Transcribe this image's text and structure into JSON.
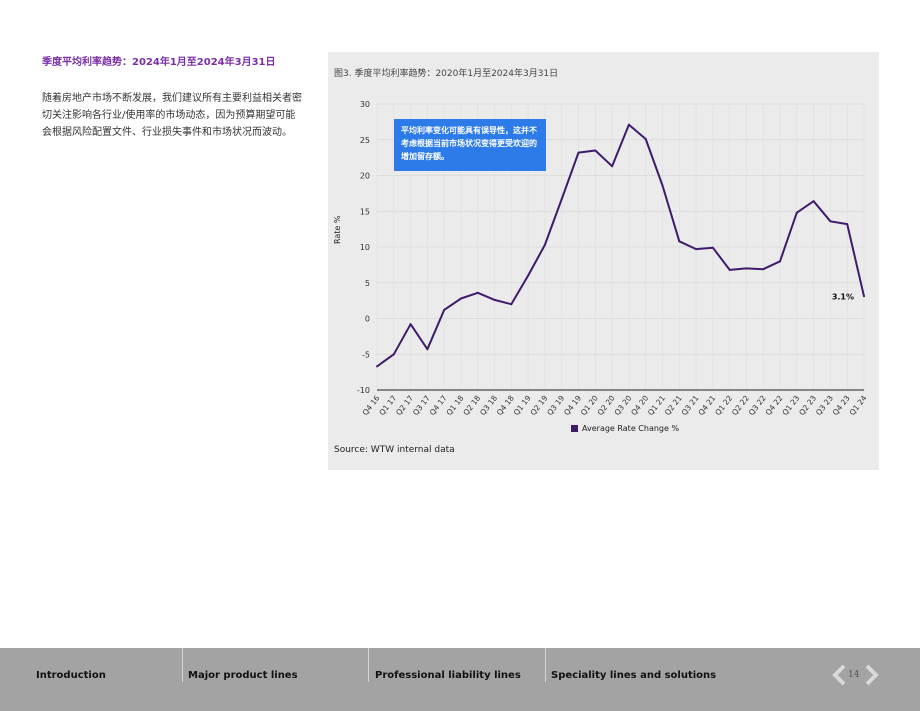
{
  "page": {
    "section_title": "季度平均利率趋势：2024年1月至2024年3月31日",
    "intro_text": "随着房地产市场不断发展，我们建议所有主要利益相关者密切关注影响各行业/使用率的市场动态，因为预算期望可能会根据风险配置文件、行业损失事件和市场状况而波动。"
  },
  "chart_data": {
    "type": "line",
    "caption": "图3. 季度平均利率趋势：2020年1月至2024年3月31日",
    "ylabel": "Rate %",
    "xlabel": "",
    "ylim": [
      -10,
      30
    ],
    "yticks": [
      30,
      25,
      20,
      15,
      10,
      5,
      0,
      -5,
      -10
    ],
    "grid": true,
    "legend_position": "bottom",
    "categories": [
      "Q4 16",
      "Q1 17",
      "Q2 17",
      "Q3 17",
      "Q4 17",
      "Q1 18",
      "Q2 18",
      "Q3 18",
      "Q4 18",
      "Q1 19",
      "Q2 19",
      "Q3 19",
      "Q4 19",
      "Q1 20",
      "Q2 20",
      "Q3 20",
      "Q4 20",
      "Q1 21",
      "Q2 21",
      "Q3 21",
      "Q4 21",
      "Q1 22",
      "Q2 22",
      "Q3 22",
      "Q4 22",
      "Q1 23",
      "Q2 23",
      "Q3 23",
      "Q4 23",
      "Q1 24"
    ],
    "series": [
      {
        "name": "Average Rate Change %",
        "color": "#3f1b6b",
        "values": [
          -6.7,
          -5.0,
          -0.8,
          -4.3,
          1.2,
          2.8,
          3.6,
          2.6,
          2.0,
          6.0,
          10.3,
          16.7,
          23.2,
          23.5,
          21.3,
          27.1,
          25.1,
          18.6,
          10.8,
          9.7,
          9.9,
          6.8,
          7.0,
          6.9,
          8.0,
          14.8,
          16.4,
          13.6,
          13.2,
          3.1
        ]
      }
    ],
    "end_label": "3.1%",
    "callout": "平均利率变化可能具有误导性，这并不考虑根据当前市场状况变得更受欢迎的增加留存额。",
    "source": "Source: WTW internal data"
  },
  "footer": {
    "nav": [
      "Introduction",
      "Major product lines",
      "Professional liability lines",
      "Speciality lines and solutions"
    ],
    "page_number": "14"
  }
}
